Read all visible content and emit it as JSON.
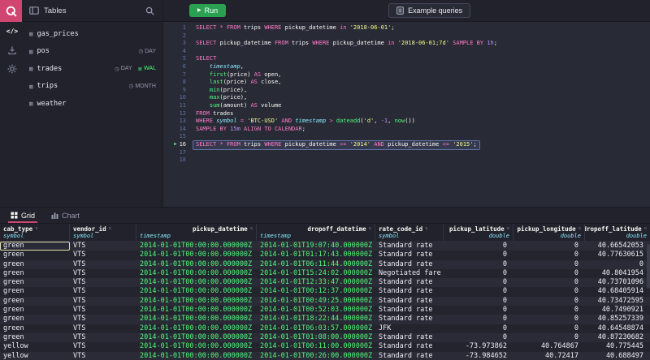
{
  "topbar": {
    "tables_label": "Tables",
    "run_label": "Run",
    "example_queries_label": "Example queries"
  },
  "icons": {
    "play": "▶",
    "marker": "▶",
    "code": "</>",
    "table": "▦",
    "sort": "⇅",
    "partition": "◷",
    "wal": "≣"
  },
  "colors": {
    "brand_accent": "#d14671",
    "run_green": "#2aa152",
    "syntax_keyword": "#ff79c6",
    "syntax_function": "#50fa7b",
    "syntax_string": "#f1fa8c",
    "syntax_number": "#bd93f9",
    "syntax_type": "#8be9fd",
    "timestamp_value": "#50fa7b"
  },
  "tables_panel": {
    "items": [
      {
        "name": "gas_prices",
        "badges": []
      },
      {
        "name": "pos",
        "badges": [
          {
            "label": "DAY",
            "kind": "partition"
          }
        ]
      },
      {
        "name": "trades",
        "badges": [
          {
            "label": "DAY",
            "kind": "partition"
          },
          {
            "label": "WAL",
            "kind": "wal"
          }
        ]
      },
      {
        "name": "trips",
        "badges": [
          {
            "label": "MONTH",
            "kind": "partition"
          }
        ]
      },
      {
        "name": "weather",
        "badges": []
      }
    ]
  },
  "editor": {
    "active_line": 16,
    "lines": [
      {
        "n": 1,
        "tokens": [
          [
            "kw",
            "SELECT"
          ],
          [
            "pl",
            " "
          ],
          [
            "op",
            "*"
          ],
          [
            "pl",
            " "
          ],
          [
            "kw",
            "FROM"
          ],
          [
            "pl",
            " trips "
          ],
          [
            "kw",
            "WHERE"
          ],
          [
            "pl",
            " pickup_datetime "
          ],
          [
            "kw",
            "in"
          ],
          [
            "pl",
            " "
          ],
          [
            "str",
            "'2018-06-01'"
          ],
          [
            "pl",
            ";"
          ]
        ]
      },
      {
        "n": 2,
        "tokens": []
      },
      {
        "n": 3,
        "tokens": [
          [
            "kw",
            "SELECT"
          ],
          [
            "pl",
            " pickup_datetime "
          ],
          [
            "kw",
            "FROM"
          ],
          [
            "pl",
            " trips "
          ],
          [
            "kw",
            "WHERE"
          ],
          [
            "pl",
            " pickup_datetime "
          ],
          [
            "kw",
            "in"
          ],
          [
            "pl",
            " "
          ],
          [
            "str",
            "'2018-06-01;7d'"
          ],
          [
            "pl",
            " "
          ],
          [
            "kw",
            "SAMPLE BY"
          ],
          [
            "pl",
            " "
          ],
          [
            "num",
            "1h"
          ],
          [
            "pl",
            ";"
          ]
        ]
      },
      {
        "n": 4,
        "tokens": []
      },
      {
        "n": 5,
        "tokens": [
          [
            "kw",
            "SELECT"
          ]
        ]
      },
      {
        "n": 6,
        "tokens": [
          [
            "pl",
            "    "
          ],
          [
            "type",
            "timestamp"
          ],
          [
            "pl",
            ","
          ]
        ]
      },
      {
        "n": 7,
        "tokens": [
          [
            "pl",
            "    "
          ],
          [
            "fn",
            "first"
          ],
          [
            "pl",
            "(price) "
          ],
          [
            "kw",
            "AS"
          ],
          [
            "pl",
            " open,"
          ]
        ]
      },
      {
        "n": 8,
        "tokens": [
          [
            "pl",
            "    "
          ],
          [
            "fn",
            "last"
          ],
          [
            "pl",
            "(price) "
          ],
          [
            "kw",
            "AS"
          ],
          [
            "pl",
            " close,"
          ]
        ]
      },
      {
        "n": 9,
        "tokens": [
          [
            "pl",
            "    "
          ],
          [
            "fn",
            "min"
          ],
          [
            "pl",
            "(price),"
          ]
        ]
      },
      {
        "n": 10,
        "tokens": [
          [
            "pl",
            "    "
          ],
          [
            "fn",
            "max"
          ],
          [
            "pl",
            "(price),"
          ]
        ]
      },
      {
        "n": 11,
        "tokens": [
          [
            "pl",
            "    "
          ],
          [
            "fn",
            "sum"
          ],
          [
            "pl",
            "(amount) "
          ],
          [
            "kw",
            "AS"
          ],
          [
            "pl",
            " volume"
          ]
        ]
      },
      {
        "n": 12,
        "tokens": [
          [
            "kw",
            "FROM"
          ],
          [
            "pl",
            " trades"
          ]
        ]
      },
      {
        "n": 13,
        "tokens": [
          [
            "kw",
            "WHERE"
          ],
          [
            "pl",
            " "
          ],
          [
            "type",
            "symbol"
          ],
          [
            "pl",
            " "
          ],
          [
            "op",
            "="
          ],
          [
            "pl",
            " "
          ],
          [
            "str",
            "'BTC-USD'"
          ],
          [
            "pl",
            " "
          ],
          [
            "kw",
            "AND"
          ],
          [
            "pl",
            " "
          ],
          [
            "type",
            "timestamp"
          ],
          [
            "pl",
            " "
          ],
          [
            "op",
            ">"
          ],
          [
            "pl",
            " "
          ],
          [
            "fn",
            "dateadd"
          ],
          [
            "pl",
            "("
          ],
          [
            "str",
            "'d'"
          ],
          [
            "pl",
            ", "
          ],
          [
            "num",
            "-1"
          ],
          [
            "pl",
            ", "
          ],
          [
            "fn",
            "now"
          ],
          [
            "pl",
            "())"
          ]
        ]
      },
      {
        "n": 14,
        "tokens": [
          [
            "kw",
            "SAMPLE BY"
          ],
          [
            "pl",
            " "
          ],
          [
            "num",
            "15m"
          ],
          [
            "pl",
            " "
          ],
          [
            "kw",
            "ALIGN TO CALENDAR"
          ],
          [
            "pl",
            ";"
          ]
        ]
      },
      {
        "n": 15,
        "tokens": []
      },
      {
        "n": 16,
        "tokens": [
          [
            "kw",
            "SELECT"
          ],
          [
            "pl",
            " "
          ],
          [
            "op",
            "*"
          ],
          [
            "pl",
            " "
          ],
          [
            "kw",
            "FROM"
          ],
          [
            "pl",
            " trips "
          ],
          [
            "kw",
            "WHERE"
          ],
          [
            "pl",
            " pickup_datetime "
          ],
          [
            "op",
            ">="
          ],
          [
            "pl",
            " "
          ],
          [
            "str",
            "'2014'"
          ],
          [
            "pl",
            " "
          ],
          [
            "kw",
            "AND"
          ],
          [
            "pl",
            " pickup_datetime "
          ],
          [
            "op",
            "<="
          ],
          [
            "pl",
            " "
          ],
          [
            "str",
            "'2015'"
          ],
          [
            "pl",
            ";"
          ]
        ]
      },
      {
        "n": 17,
        "tokens": []
      },
      {
        "n": 18,
        "tokens": []
      }
    ]
  },
  "results": {
    "tabs": [
      {
        "label": "Grid",
        "active": true
      },
      {
        "label": "Chart",
        "active": false
      }
    ],
    "columns": [
      {
        "name": "cab_type",
        "type": "symbol"
      },
      {
        "name": "vendor_id",
        "type": "symbol"
      },
      {
        "name": "pickup_datetime",
        "type": "timestamp"
      },
      {
        "name": "dropoff_datetime",
        "type": "timestamp"
      },
      {
        "name": "rate_code_id",
        "type": "symbol"
      },
      {
        "name": "pickup_latitude",
        "type": "double"
      },
      {
        "name": "pickup_longitude",
        "type": "double"
      },
      {
        "name": "dropoff_latitude",
        "type": "double"
      }
    ],
    "focused_cell": {
      "row": 0,
      "col": 0
    },
    "rows": [
      [
        "green",
        "VTS",
        "2014-01-01T00:00:00.000000Z",
        "2014-01-01T19:07:40.000000Z",
        "Standard rate",
        "0",
        "0",
        "40.66542053"
      ],
      [
        "green",
        "VTS",
        "2014-01-01T00:00:00.000000Z",
        "2014-01-01T01:17:43.000000Z",
        "Standard rate",
        "0",
        "0",
        "40.77630615"
      ],
      [
        "green",
        "VTS",
        "2014-01-01T00:00:00.000000Z",
        "2014-01-01T06:11:44.000000Z",
        "Standard rate",
        "0",
        "0",
        "0"
      ],
      [
        "green",
        "VTS",
        "2014-01-01T00:00:00.000000Z",
        "2014-01-01T15:24:02.000000Z",
        "Negotiated fare",
        "0",
        "0",
        "40.8041954"
      ],
      [
        "green",
        "VTS",
        "2014-01-01T00:00:00.000000Z",
        "2014-01-01T12:33:47.000000Z",
        "Standard rate",
        "0",
        "0",
        "40.73701096"
      ],
      [
        "green",
        "VTS",
        "2014-01-01T00:00:00.000000Z",
        "2014-01-01T00:12:37.000000Z",
        "Standard rate",
        "0",
        "0",
        "40.68405914"
      ],
      [
        "green",
        "VTS",
        "2014-01-01T00:00:00.000000Z",
        "2014-01-01T00:49:25.000000Z",
        "Standard rate",
        "0",
        "0",
        "40.73472595"
      ],
      [
        "green",
        "VTS",
        "2014-01-01T00:00:00.000000Z",
        "2014-01-01T00:52:03.000000Z",
        "Standard rate",
        "0",
        "0",
        "40.7490921"
      ],
      [
        "green",
        "VTS",
        "2014-01-01T00:00:00.000000Z",
        "2014-01-01T18:22:44.000000Z",
        "Standard rate",
        "0",
        "0",
        "40.85257339"
      ],
      [
        "green",
        "VTS",
        "2014-01-01T00:00:00.000000Z",
        "2014-01-01T06:03:57.000000Z",
        "JFK",
        "0",
        "0",
        "40.64548874"
      ],
      [
        "green",
        "VTS",
        "2014-01-01T00:00:00.000000Z",
        "2014-01-01T01:08:00.000000Z",
        "Standard rate",
        "0",
        "0",
        "40.87230682"
      ],
      [
        "yellow",
        "VTS",
        "2014-01-01T00:00:00.000000Z",
        "2014-01-01T00:11:00.000000Z",
        "Standard rate",
        "-73.973862",
        "40.764867",
        "40.775445"
      ],
      [
        "yellow",
        "VTS",
        "2014-01-01T00:00:00.000000Z",
        "2014-01-01T00:26:00.000000Z",
        "Standard rate",
        "-73.984652",
        "40.72417",
        "40.688497"
      ]
    ]
  }
}
